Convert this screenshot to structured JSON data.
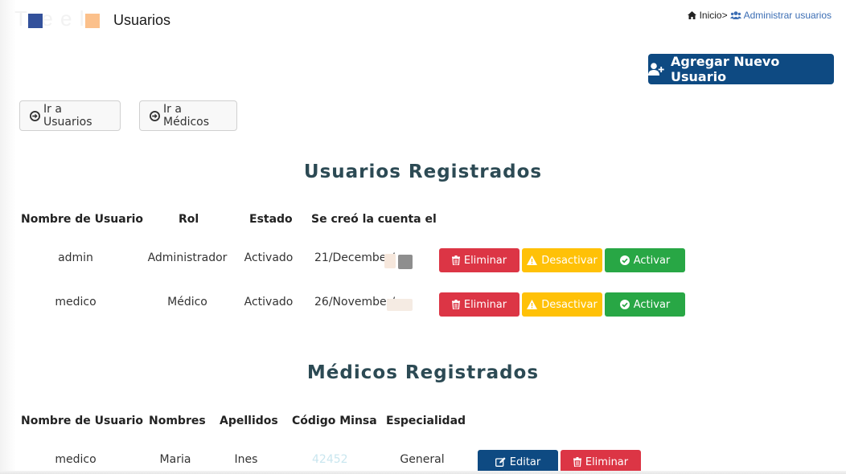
{
  "header": {
    "title": "Usuarios",
    "brand_colors": {
      "square_1": "#33519b",
      "square_2": "#fbc08b"
    }
  },
  "breadcrumb": {
    "home_label": "Inicio",
    "separator": ">",
    "current_label": "Administrar usuarios"
  },
  "actions": {
    "add_user_label": "Agregar Nuevo Usuario"
  },
  "nav": {
    "go_users_label": "Ir a Usuarios",
    "go_doctors_label": "Ir a Médicos"
  },
  "users_section": {
    "title": "Usuarios Registrados",
    "columns": [
      "Nombre de Usuario",
      "Rol",
      "Estado",
      "Se creó la cuenta el"
    ],
    "rows": [
      {
        "username": "admin",
        "role": "Administrador",
        "status": "Activado",
        "created": "21/December/"
      },
      {
        "username": "medico",
        "role": "Médico",
        "status": "Activado",
        "created": "26/November/"
      }
    ],
    "buttons": {
      "delete": "Eliminar",
      "deactivate": "Desactivar",
      "activate": "Activar"
    }
  },
  "doctors_section": {
    "title": "Médicos Registrados",
    "columns": [
      "Nombre de Usuario",
      "Nombres",
      "Apellidos",
      "Código Minsa",
      "Especialidad"
    ],
    "rows": [
      {
        "username": "medico",
        "names": "Maria",
        "surnames": "Ines",
        "code": "42452",
        "specialty": "General"
      }
    ],
    "buttons": {
      "edit": "Editar",
      "delete": "Eliminar"
    }
  },
  "colors": {
    "primary": "#0e4a82",
    "danger": "#dc3545",
    "warning": "#ffc107",
    "success": "#28a745",
    "heading": "#2c4a54"
  }
}
